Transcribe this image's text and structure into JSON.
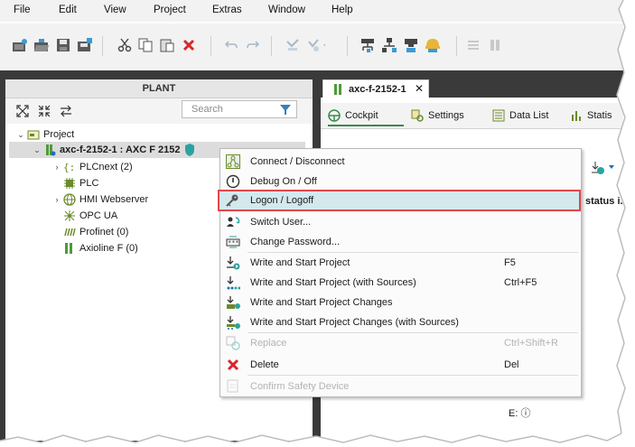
{
  "menu": [
    "File",
    "Edit",
    "View",
    "Project",
    "Extras",
    "Window",
    "Help"
  ],
  "toolbar_icons": [
    "new-project-icon",
    "open-project-icon",
    "save-icon",
    "save-as-icon",
    "cut-icon",
    "copy-icon",
    "paste-icon",
    "delete-icon",
    "undo-icon",
    "redo-icon",
    "compile-icon",
    "build-icon",
    "network-icon",
    "network-alt-icon",
    "online-icon",
    "safety-icon",
    "layout-icon",
    "layout-alt-icon"
  ],
  "plant": {
    "title": "PLANT",
    "search_placeholder": "Search",
    "tree": [
      {
        "label": "Project",
        "icon": "project-icon"
      },
      {
        "label": "axc-f-2152-1 : AXC F 2152",
        "icon": "controller-icon"
      },
      {
        "label": "PLCnext (2)",
        "icon": "plcnext-icon"
      },
      {
        "label": "PLC",
        "icon": "plc-chip-icon"
      },
      {
        "label": "HMI Webserver",
        "icon": "globe-icon"
      },
      {
        "label": "OPC UA",
        "icon": "opcua-icon"
      },
      {
        "label": "Profinet (0)",
        "icon": "profinet-icon"
      },
      {
        "label": "Axioline F (0)",
        "icon": "axioline-icon"
      }
    ]
  },
  "editor": {
    "tab_title": "axc-f-2152-1",
    "close": "✕",
    "subtabs": [
      "Cockpit",
      "Settings",
      "Data List",
      "Statis"
    ],
    "status_label": "status i...",
    "footer_text": "E: ⓘ"
  },
  "context_menu": {
    "items": [
      {
        "label": "Connect / Disconnect",
        "shortcut": "",
        "icon": "connect-icon",
        "disabled": false
      },
      {
        "label": "Debug On / Off",
        "shortcut": "",
        "icon": "debug-icon",
        "disabled": false
      },
      {
        "label": "Logon / Logoff",
        "shortcut": "",
        "icon": "key-icon",
        "disabled": false,
        "highlighted": true
      },
      {
        "label": "Switch User...",
        "shortcut": "",
        "icon": "switch-user-icon",
        "disabled": false
      },
      {
        "label": "Change Password...",
        "shortcut": "",
        "icon": "password-icon",
        "disabled": false
      },
      {
        "label": "Write and Start Project",
        "shortcut": "F5",
        "icon": "write-start-icon",
        "disabled": false
      },
      {
        "label": "Write and Start Project (with Sources)",
        "shortcut": "Ctrl+F5",
        "icon": "write-start-sources-icon",
        "disabled": false
      },
      {
        "label": "Write and Start Project Changes",
        "shortcut": "",
        "icon": "write-changes-icon",
        "disabled": false
      },
      {
        "label": "Write and Start Project Changes (with Sources)",
        "shortcut": "",
        "icon": "write-changes-sources-icon",
        "disabled": false
      },
      {
        "label": "Replace",
        "shortcut": "Ctrl+Shift+R",
        "icon": "replace-icon",
        "disabled": true
      },
      {
        "label": "Delete",
        "shortcut": "Del",
        "icon": "delete-icon",
        "disabled": false
      },
      {
        "label": "Confirm Safety Device",
        "shortcut": "",
        "icon": "confirm-safety-icon",
        "disabled": true
      }
    ]
  },
  "colors": {
    "accent_green": "#3a8a4a",
    "highlight_border": "#e0474c",
    "highlight_fill": "#d4e9ee",
    "delete_red": "#d9262c",
    "frame_dark": "#3a3a3a"
  }
}
